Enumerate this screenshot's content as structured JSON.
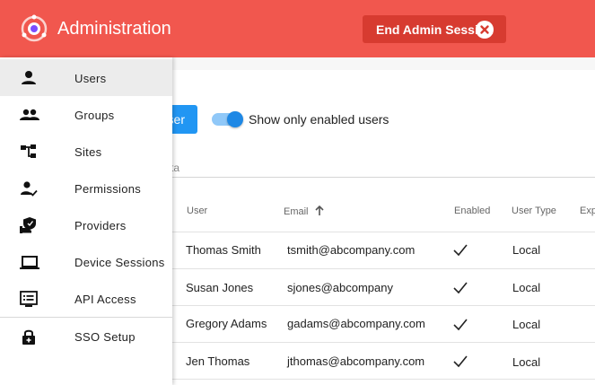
{
  "header": {
    "title": "Administration",
    "end_session_label": "End Admin Session",
    "brand_color": "#f1574e"
  },
  "toolbar": {
    "add_user_label_visible": "ser",
    "toggle_label": "Show only enabled users",
    "toggle_on": true
  },
  "tab_stub": "ta",
  "table": {
    "headers": {
      "user": "User",
      "email": "Email",
      "enabled": "Enabled",
      "user_type": "User Type",
      "expires": "Expi"
    },
    "rows": [
      {
        "user": "Thomas Smith",
        "email": "tsmith@abcompany.com",
        "enabled": "✓",
        "type": "Local"
      },
      {
        "user": "Susan Jones",
        "email": "sjones@abcompany",
        "enabled": "✓",
        "type": "Local"
      },
      {
        "user": "Gregory Adams",
        "email": "gadams@abcompany.com",
        "enabled": "✓",
        "type": "Local"
      },
      {
        "user": "Jen Thomas",
        "email": "jthomas@abcompany.com",
        "enabled": "✓",
        "type": "Local"
      }
    ]
  },
  "sidebar": {
    "items": [
      {
        "label": "Users",
        "icon": "person-icon",
        "active": true
      },
      {
        "label": "Groups",
        "icon": "people-icon"
      },
      {
        "label": "Sites",
        "icon": "sitemap-icon"
      },
      {
        "label": "Permissions",
        "icon": "person-check-icon"
      },
      {
        "label": "Providers",
        "icon": "shield-hand-icon"
      },
      {
        "label": "Device Sessions",
        "icon": "laptop-icon"
      },
      {
        "label": "API Access",
        "icon": "api-list-icon"
      },
      {
        "label": "SSO Setup",
        "icon": "lock-icon"
      }
    ]
  },
  "colors": {
    "accent": "#2196f3",
    "end_session_bg": "#d73b30"
  }
}
